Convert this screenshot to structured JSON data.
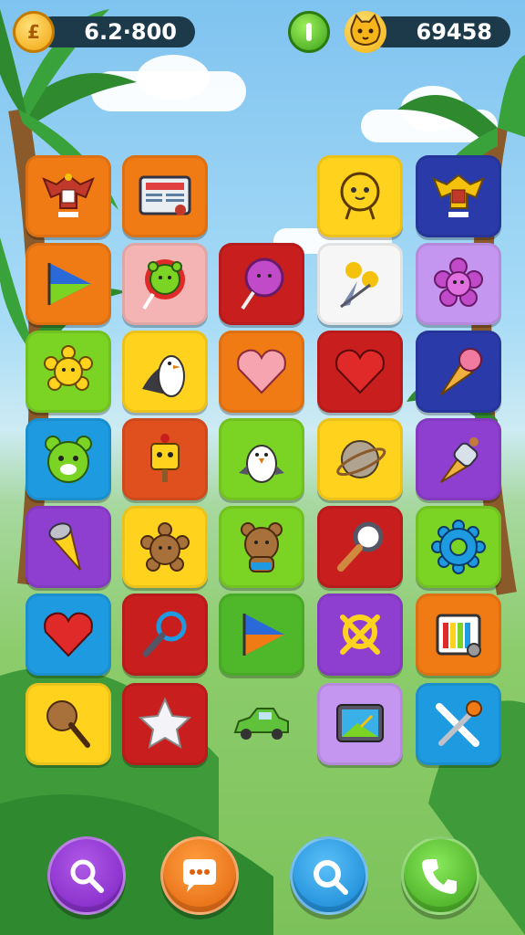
{
  "hud": {
    "coins": "6.2·800",
    "score": "69458",
    "coin_icon": "coin-icon",
    "center_icon": "info-icon",
    "score_icon": "cat-face-icon"
  },
  "colors": {
    "orange": "#f07a14",
    "yellow": "#ffd21e",
    "red": "#c81e1e",
    "green": "#7bd324",
    "purple": "#8f3fd0",
    "blue": "#1e9be0",
    "navy": "#2a3aa8",
    "pink": "#f4b4b4",
    "lilac": "#c596f0",
    "white": "#f6f6f6"
  },
  "grid": {
    "rows": [
      [
        "emblem",
        "newspaper",
        "",
        "yellow-creature",
        "emblem"
      ],
      [
        "play",
        "bear-lollipop",
        "pink-lollipop",
        "flower-bouquet",
        "flower"
      ],
      [
        "sun-flower",
        "penguin",
        "heart",
        "heart",
        "ice-cream"
      ],
      [
        "bear",
        "robot",
        "penguin",
        "planet",
        "ice-cream"
      ],
      [
        "ice-cream",
        "teddy-bear",
        "teddy-bear",
        "magnifier",
        "gear"
      ],
      [
        "heart",
        "magnifier",
        "play",
        "magnifier-x",
        "battery"
      ],
      [
        "spoon",
        "star",
        "car",
        "tablet",
        "ice-cream-cross"
      ]
    ]
  },
  "bottom_bar": {
    "buttons": [
      {
        "icon": "magnifier-icon",
        "color": "#8a2fd0"
      },
      {
        "icon": "chat-bubble-icon",
        "color": "#f07a14"
      },
      {
        "icon": "search-icon",
        "color": "#1e9be0"
      },
      {
        "icon": "phone-icon",
        "color": "#4fc21e"
      }
    ]
  }
}
